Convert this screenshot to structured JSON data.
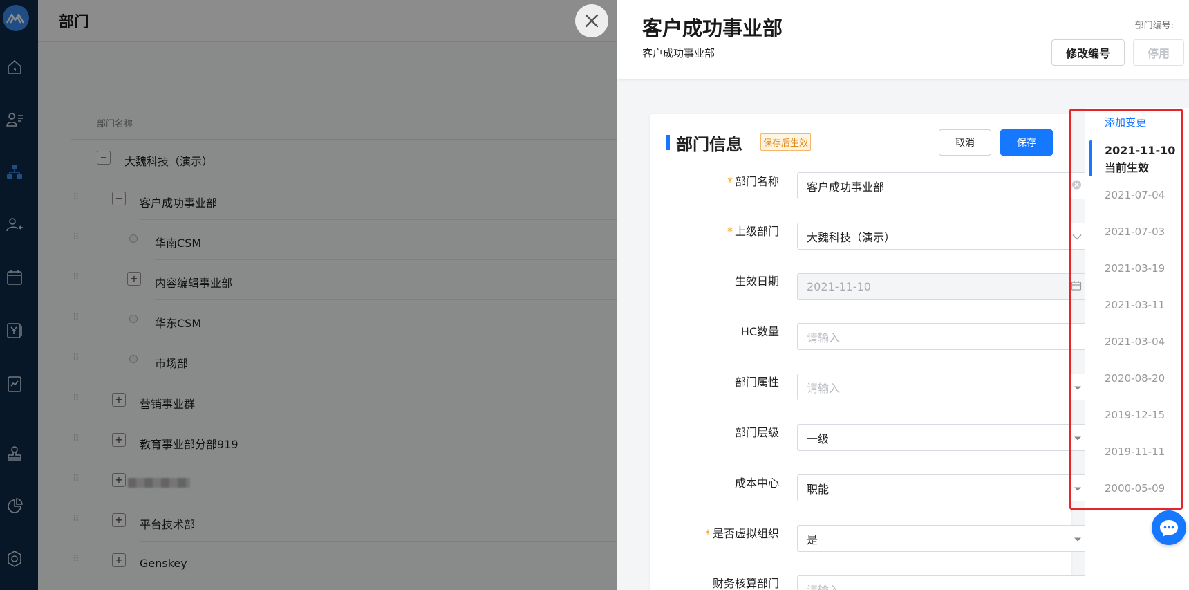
{
  "background_page": {
    "title": "部门",
    "column_header": "部门名称",
    "rows": [
      {
        "label": "大魏科技（演示）",
        "icon": "minus"
      },
      {
        "label": "客户成功事业部",
        "icon": "minus"
      },
      {
        "label": "华南CSM",
        "icon": "dot"
      },
      {
        "label": "内容编辑事业部",
        "icon": "plus"
      },
      {
        "label": "华东CSM",
        "icon": "dot"
      },
      {
        "label": "市场部",
        "icon": "dot"
      },
      {
        "label": "营销事业群",
        "icon": "plus"
      },
      {
        "label": "教育事业部分部919",
        "icon": "plus"
      },
      {
        "label": "",
        "icon": "plus"
      },
      {
        "label": "平台技术部",
        "icon": "plus"
      },
      {
        "label": "Genskey",
        "icon": "plus"
      }
    ]
  },
  "drawer": {
    "title": "客户成功事业部",
    "subtitle": "客户成功事业部",
    "code_label": "部门编号:",
    "edit_code_button": "修改编号",
    "disable_button": "停用"
  },
  "card": {
    "title": "部门信息",
    "tag": "保存后生效",
    "cancel_button": "取消",
    "save_button": "保存",
    "fields": {
      "name": {
        "label": "部门名称",
        "value": "客户成功事业部"
      },
      "parent": {
        "label": "上级部门",
        "value": "大魏科技（演示）"
      },
      "effective_date": {
        "label": "生效日期",
        "value": "2021-11-10"
      },
      "hc": {
        "label": "HC数量",
        "placeholder": "请输入"
      },
      "attribute": {
        "label": "部门属性",
        "placeholder": "请输入"
      },
      "level": {
        "label": "部门层级",
        "value": "一级"
      },
      "cost_center": {
        "label": "成本中心",
        "value": "职能"
      },
      "virtual": {
        "label": "是否虚拟组织",
        "value": "是"
      },
      "finance": {
        "label": "财务核算部门",
        "placeholder": "请输入"
      }
    }
  },
  "timeline": {
    "add_label": "添加变更",
    "current_date": "2021-11-10",
    "current_label": "当前生效",
    "dates": [
      "2021-07-04",
      "2021-07-03",
      "2021-03-19",
      "2021-03-11",
      "2021-03-04",
      "2020-08-20",
      "2019-12-15",
      "2019-11-11",
      "2000-05-09"
    ]
  },
  "colors": {
    "nav_bg": "#0e2a4a",
    "accent": "#1677ff",
    "highlight_border": "#e6252b"
  }
}
